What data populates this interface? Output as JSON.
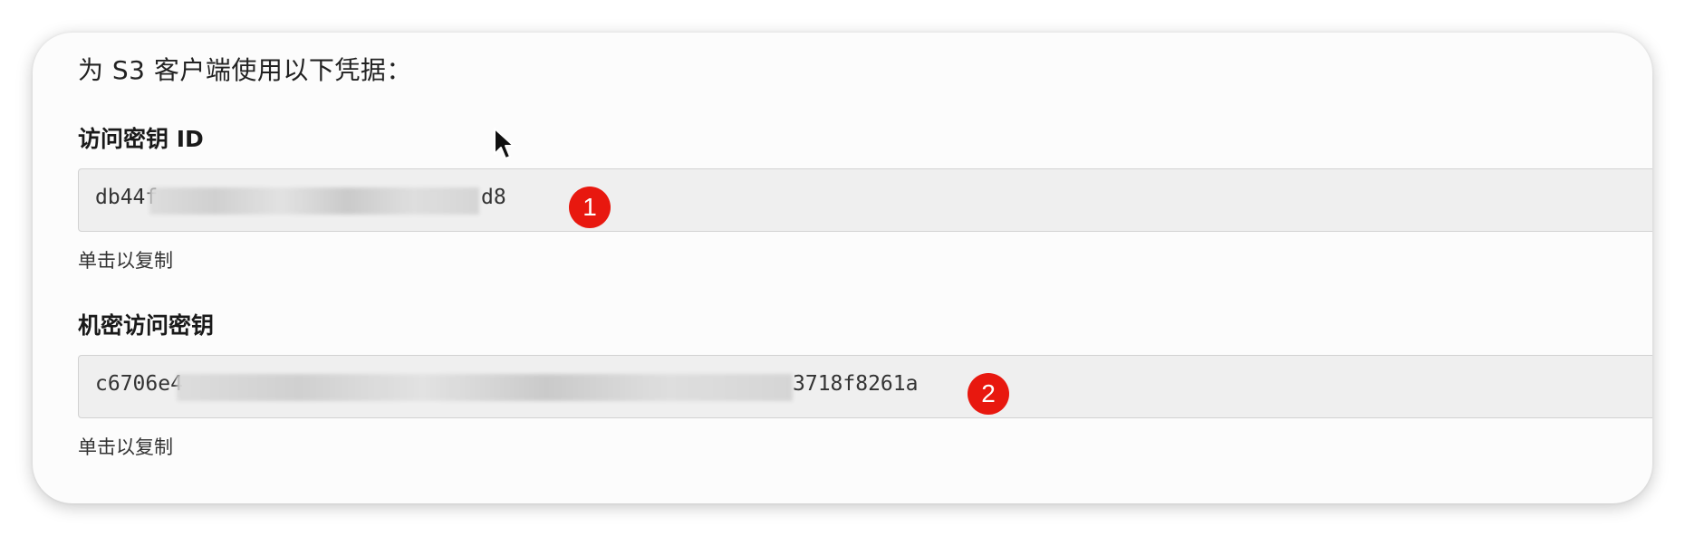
{
  "intro_text": "为 S3 客户端使用以下凭据：",
  "access_key": {
    "label": "访问密钥 ID",
    "value_prefix": "db44f",
    "value_suffix": "d8",
    "hint": "单击以复制",
    "marker": "1"
  },
  "secret_key": {
    "label": "机密访问密钥",
    "value_prefix": "c6706e4",
    "value_suffix": "3718f8261a",
    "hint": "单击以复制",
    "marker": "2"
  },
  "colors": {
    "marker": "#e8180f",
    "field_bg": "#efefef",
    "card_bg": "#fcfcfc"
  },
  "icons": {
    "cursor": "arrow-cursor-icon"
  }
}
